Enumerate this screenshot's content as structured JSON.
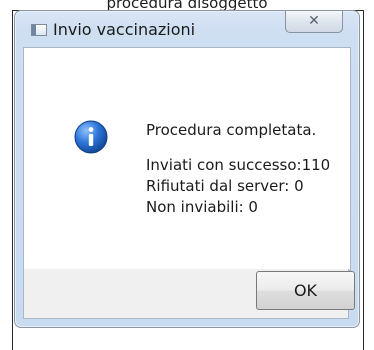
{
  "top_text": "procedura disoggetto",
  "window": {
    "title": "Invio vaccinazioni",
    "close_icon": "close-icon"
  },
  "message": {
    "icon": "info-icon",
    "headline": "Procedura completata.",
    "lines": [
      "Inviati con successo:110",
      "Rifiutati dal server:  0",
      "Non inviabili: 0"
    ]
  },
  "buttons": {
    "ok_label": "OK",
    "close_label": "✕"
  },
  "colors": {
    "frame_blue": "#c9dbf1",
    "border_gray": "#8c96a3",
    "info_blue": "#2b74d8",
    "footer_gray": "#f0f0f0"
  }
}
